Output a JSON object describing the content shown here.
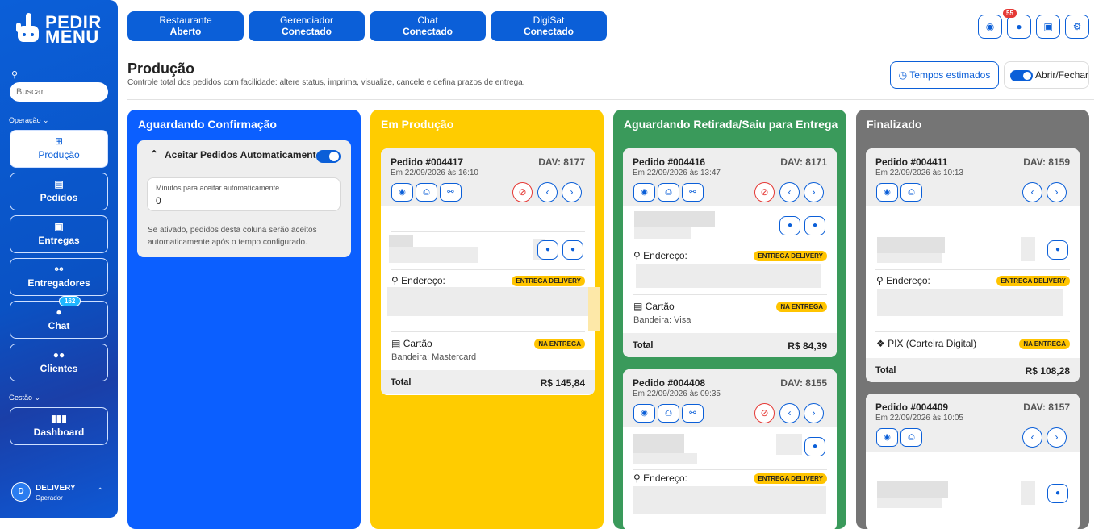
{
  "sidebar": {
    "logo_line1": "PEDIR",
    "logo_line2": "MENU",
    "search_placeholder": "Buscar",
    "section_operacao": "Operação",
    "section_gestao": "Gestão",
    "items": [
      {
        "label": "Produção",
        "icon": "grid-icon"
      },
      {
        "label": "Pedidos",
        "icon": "receipt-icon"
      },
      {
        "label": "Entregas",
        "icon": "boxes-icon"
      },
      {
        "label": "Entregadores",
        "icon": "motorcycle-icon"
      },
      {
        "label": "Chat",
        "icon": "chat-icon",
        "badge": "162"
      },
      {
        "label": "Clientes",
        "icon": "users-icon"
      },
      {
        "label": "Dashboard",
        "icon": "chart-icon"
      }
    ],
    "user": {
      "initial": "D",
      "name": "DELIVERY",
      "role": "Operador"
    }
  },
  "status": [
    {
      "name": "Restaurante",
      "state": "Aberto"
    },
    {
      "name": "Gerenciador",
      "state": "Conectado"
    },
    {
      "name": "Chat",
      "state": "Conectado"
    },
    {
      "name": "DigiSat",
      "state": "Conectado"
    }
  ],
  "topbar": {
    "alerts_badge": "55"
  },
  "page": {
    "title": "Produção",
    "subtitle": "Controle total dos pedidos com facilidade: altere status, imprima, visualize, cancele e defina prazos de entrega.",
    "tempos_label": "Tempos estimados",
    "toggle_label": "Abrir/Fechar"
  },
  "columns": {
    "c1": {
      "title": "Aguardando Confirmação",
      "color": "#0b5fff",
      "auto": {
        "title": "Aceitar Pedidos Automaticamente",
        "field_label": "Minutos para aceitar automaticamente",
        "field_value": "0",
        "note": "Se ativado, pedidos desta coluna serão aceitos automaticamente após o tempo configurado."
      }
    },
    "c2": {
      "title": "Em Produção",
      "color": "#ffcc00"
    },
    "c3": {
      "title": "Aguardando Retirada/Saiu para Entrega",
      "color": "#3a9a5b"
    },
    "c4": {
      "title": "Finalizado",
      "color": "#757575"
    }
  },
  "common": {
    "address_label": "Endereço:",
    "total_label": "Total",
    "delivery_tag": "ENTREGA DELIVERY",
    "payment_tag": "NA ENTREGA"
  },
  "orders": {
    "o417": {
      "id": "Pedido #004417",
      "dav": "DAV: 8177",
      "date": "Em 22/09/2026 às 16:10",
      "payment": "Cartão",
      "brand": "Bandeira: Mastercard",
      "total": "R$ 145,84"
    },
    "o416": {
      "id": "Pedido #004416",
      "dav": "DAV: 8171",
      "date": "Em 22/09/2026 às 13:47",
      "payment": "Cartão",
      "brand": "Bandeira: Visa",
      "total": "R$ 84,39"
    },
    "o408": {
      "id": "Pedido #004408",
      "dav": "DAV: 8155",
      "date": "Em 22/09/2026 às 09:35"
    },
    "o411": {
      "id": "Pedido #004411",
      "dav": "DAV: 8159",
      "date": "Em 22/09/2026 às 10:13",
      "payment": "PIX (Carteira Digital)",
      "total": "R$ 108,28"
    },
    "o409": {
      "id": "Pedido #004409",
      "dav": "DAV: 8157",
      "date": "Em 22/09/2026 às 10:05"
    }
  }
}
